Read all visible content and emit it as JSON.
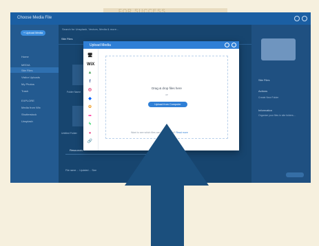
{
  "background_text": "FOR SUCCESS",
  "app": {
    "title": "Choose Media File",
    "sidebar": {
      "upload_button": "+ Upload Media",
      "items": [
        "Home",
        "MEDIA",
        "Site Files",
        "Visitor Uploads",
        "My Photos",
        "Trash",
        "EXPLORE",
        "Media from Wix",
        "Shutterstock",
        "Unsplash"
      ]
    },
    "main": {
      "search_placeholder": "Search for Unsplash, Vectors, Media & more...",
      "header": "Site Files",
      "card_labels": [
        "Folder Name",
        "Untitled Folder"
      ],
      "tab": "Resources",
      "row_text": "File name   ...   Updated   ...   Size"
    },
    "right_panel": {
      "site_files_label": "Site Files",
      "actions_label": "Actions",
      "create_folder": "Create New Folder",
      "information_label": "Information",
      "info_text": "Organize your files in site folders..."
    }
  },
  "modal": {
    "title": "Upload Media",
    "sources": [
      {
        "name": "computer-icon",
        "color": "#222222",
        "glyph": "🖥"
      },
      {
        "name": "wix-logo",
        "color": "#111111",
        "glyph": "WiX"
      },
      {
        "name": "google-drive-icon",
        "color": "#4aa05a",
        "glyph": "▲"
      },
      {
        "name": "facebook-icon",
        "color": "#3b5998",
        "glyph": "f"
      },
      {
        "name": "instagram-icon",
        "color": "#e1306c",
        "glyph": "◎"
      },
      {
        "name": "dropbox-icon",
        "color": "#0061fe",
        "glyph": "◆"
      },
      {
        "name": "google-photos-icon",
        "color": "#f0a030",
        "glyph": "✿"
      },
      {
        "name": "flickr-icon",
        "color": "#ff0084",
        "glyph": "••"
      },
      {
        "name": "deviantart-icon",
        "color": "#05cc47",
        "glyph": "ϟ"
      },
      {
        "name": "dribbble-icon",
        "color": "#ea4c89",
        "glyph": "●"
      },
      {
        "name": "link-icon",
        "color": "#555555",
        "glyph": "🔗"
      }
    ],
    "drop_text": "Drag & drop files here",
    "or_text": "or",
    "upload_button": "Upload from Computer",
    "footer_text": "Want to see which files can be uploaded?",
    "footer_link": "Read more"
  },
  "colors": {
    "arrow": "#1b4f7d",
    "accent": "#2f7fd6"
  }
}
